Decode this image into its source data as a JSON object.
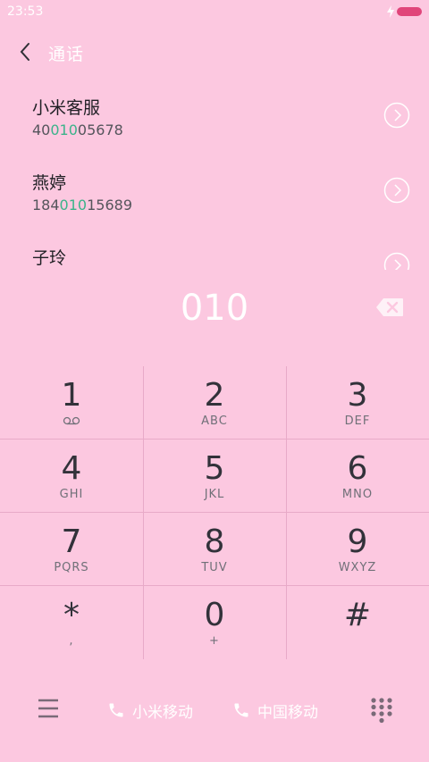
{
  "status": {
    "time": "23:53"
  },
  "header": {
    "title": "通话"
  },
  "contacts": [
    {
      "name": "小米客服",
      "number_pre": "40",
      "number_match": "010",
      "number_post": "05678"
    },
    {
      "name": "燕婷",
      "number_pre": "184",
      "number_match": "010",
      "number_post": "15689"
    },
    {
      "name": "子玲",
      "number_pre": "",
      "number_match": "",
      "number_post": ""
    }
  ],
  "dialer": {
    "number": "010"
  },
  "keypad": [
    {
      "digit": "1",
      "letters": ""
    },
    {
      "digit": "2",
      "letters": "ABC"
    },
    {
      "digit": "3",
      "letters": "DEF"
    },
    {
      "digit": "4",
      "letters": "GHI"
    },
    {
      "digit": "5",
      "letters": "JKL"
    },
    {
      "digit": "6",
      "letters": "MNO"
    },
    {
      "digit": "7",
      "letters": "PQRS"
    },
    {
      "digit": "8",
      "letters": "TUV"
    },
    {
      "digit": "9",
      "letters": "WXYZ"
    },
    {
      "digit": "*",
      "letters": ","
    },
    {
      "digit": "0",
      "letters": "+"
    },
    {
      "digit": "#",
      "letters": ""
    }
  ],
  "bottom": {
    "sim1_label": "小米移动",
    "sim2_label": "中国移动"
  },
  "colors": {
    "background": "#fcc8e0",
    "match_highlight": "#3bb38a",
    "battery": "#e0457a"
  }
}
